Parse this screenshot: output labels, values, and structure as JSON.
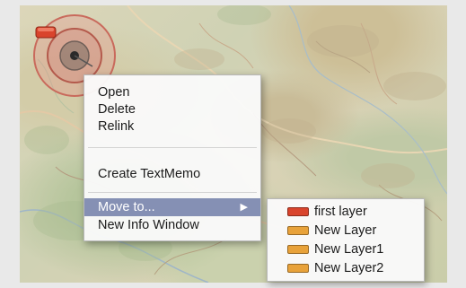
{
  "context_menu": {
    "items": [
      {
        "label": "Open"
      },
      {
        "label": "Delete"
      },
      {
        "label": "Relink"
      },
      {
        "label": "Create TextMemo"
      },
      {
        "label": "Move to...",
        "selected": true,
        "has_submenu": true,
        "submenu_icon": "triangle-right-icon"
      },
      {
        "label": "New Info Window"
      }
    ]
  },
  "move_to_submenu": {
    "layers": [
      {
        "label": "first layer",
        "color": "#d9442c"
      },
      {
        "label": "New Layer",
        "color": "#e8a23a"
      },
      {
        "label": "New Layer1",
        "color": "#e8a23a"
      },
      {
        "label": "New Layer2",
        "color": "#e8a23a"
      }
    ]
  },
  "colors": {
    "selection": "#8590b4",
    "pin_red": "#d9442c",
    "target_ring": "#c96a5c"
  }
}
